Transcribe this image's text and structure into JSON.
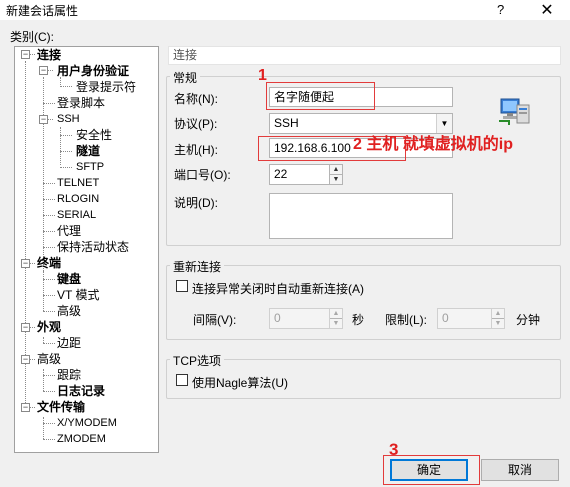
{
  "window": {
    "title": "新建会话属性",
    "help": "?",
    "close": "✕"
  },
  "category_label": "类别(C):",
  "tree": {
    "items": [
      {
        "label": "连接",
        "bold": true
      },
      {
        "label": "用户身份验证",
        "bold": true
      },
      {
        "label": "登录提示符"
      },
      {
        "label": "登录脚本"
      },
      {
        "label": "SSH"
      },
      {
        "label": "安全性"
      },
      {
        "label": "隧道",
        "bold": true
      },
      {
        "label": "SFTP"
      },
      {
        "label": "TELNET"
      },
      {
        "label": "RLOGIN"
      },
      {
        "label": "SERIAL"
      },
      {
        "label": "代理"
      },
      {
        "label": "保持活动状态"
      },
      {
        "label": "终端",
        "bold": true
      },
      {
        "label": "键盘",
        "bold": true
      },
      {
        "label": "VT 模式"
      },
      {
        "label": "高级"
      },
      {
        "label": "外观",
        "bold": true
      },
      {
        "label": "边距"
      },
      {
        "label": "高级"
      },
      {
        "label": "跟踪"
      },
      {
        "label": "日志记录",
        "bold": true
      },
      {
        "label": "文件传输",
        "bold": true
      },
      {
        "label": "X/YMODEM"
      },
      {
        "label": "ZMODEM"
      }
    ]
  },
  "panel": {
    "header": "连接",
    "general": {
      "title": "常规",
      "name_label": "名称(N):",
      "name_value": "名字随便起",
      "protocol_label": "协议(P):",
      "protocol_value": "SSH",
      "host_label": "主机(H):",
      "host_value": "192.168.6.100",
      "port_label": "端口号(O):",
      "port_value": "22",
      "desc_label": "说明(D):",
      "desc_value": ""
    },
    "reconnect": {
      "title": "重新连接",
      "checkbox_label": "连接异常关闭时自动重新连接(A)",
      "checked": false,
      "interval_label": "间隔(V):",
      "interval_value": "0",
      "interval_unit": "秒",
      "limit_label": "限制(L):",
      "limit_value": "0",
      "limit_unit": "分钟"
    },
    "tcp": {
      "title": "TCP选项",
      "checkbox_label": "使用Nagle算法(U)",
      "checked": false
    }
  },
  "buttons": {
    "ok": "确定",
    "cancel": "取消"
  },
  "annotations": {
    "n1": "1",
    "n2": "2 主机 就填虚拟机的ip",
    "n3": "3",
    "color": "#e02020"
  }
}
